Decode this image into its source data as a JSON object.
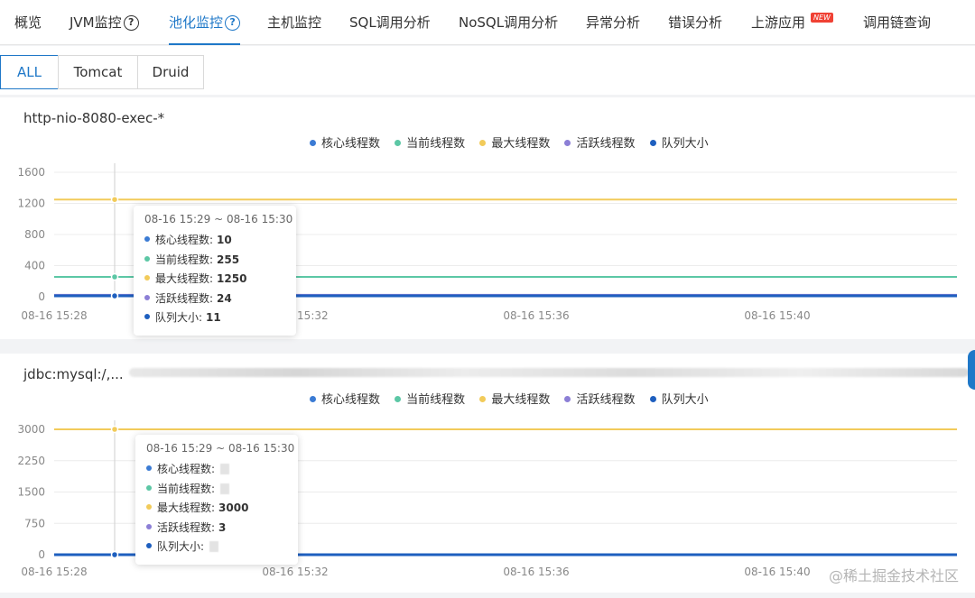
{
  "tabs": [
    {
      "label": "概览",
      "active": false,
      "help": false
    },
    {
      "label": "JVM监控",
      "active": false,
      "help": true
    },
    {
      "label": "池化监控",
      "active": true,
      "help": true
    },
    {
      "label": "主机监控",
      "active": false,
      "help": false
    },
    {
      "label": "SQL调用分析",
      "active": false,
      "help": false
    },
    {
      "label": "NoSQL调用分析",
      "active": false,
      "help": false
    },
    {
      "label": "异常分析",
      "active": false,
      "help": false
    },
    {
      "label": "错误分析",
      "active": false,
      "help": false
    },
    {
      "label": "上游应用",
      "active": false,
      "help": false,
      "badge": "NEW"
    },
    {
      "label": "调用链查询",
      "active": false,
      "help": false
    }
  ],
  "help_glyph": "?",
  "subtabs": [
    {
      "label": "ALL",
      "active": true
    },
    {
      "label": "Tomcat",
      "active": false
    },
    {
      "label": "Druid",
      "active": false
    }
  ],
  "colors": {
    "accent": "#1f78c8",
    "core": "#3b7bd4",
    "current": "#5cc7a5",
    "max": "#f2cb5a",
    "active": "#8c7fd6",
    "queue": "#1e5fbf"
  },
  "legend": [
    {
      "label": "核心线程数",
      "color_key": "core"
    },
    {
      "label": "当前线程数",
      "color_key": "current"
    },
    {
      "label": "最大线程数",
      "color_key": "max"
    },
    {
      "label": "活跃线程数",
      "color_key": "active"
    },
    {
      "label": "队列大小",
      "color_key": "queue"
    }
  ],
  "panels": [
    {
      "title": "http-nio-8080-exec-*",
      "tooltip": {
        "title": "08-16 15:29 ~ 08-16 15:30",
        "rows": [
          {
            "label": "核心线程数:",
            "value": "10",
            "color_key": "core"
          },
          {
            "label": "当前线程数:",
            "value": "255",
            "color_key": "current"
          },
          {
            "label": "最大线程数:",
            "value": "1250",
            "color_key": "max"
          },
          {
            "label": "活跃线程数:",
            "value": "24",
            "color_key": "active"
          },
          {
            "label": "队列大小:",
            "value": "11",
            "color_key": "queue"
          }
        ]
      }
    },
    {
      "title": "jdbc:mysql:/,...",
      "tooltip": {
        "title": "08-16 15:29 ~ 08-16 15:30",
        "rows": [
          {
            "label": "核心线程数:",
            "value": "",
            "color_key": "core"
          },
          {
            "label": "当前线程数:",
            "value": "",
            "color_key": "current"
          },
          {
            "label": "最大线程数:",
            "value": "3000",
            "color_key": "max"
          },
          {
            "label": "活跃线程数:",
            "value": "3",
            "color_key": "active"
          },
          {
            "label": "队列大小:",
            "value": "",
            "color_key": "queue"
          }
        ]
      }
    }
  ],
  "chart_data": [
    {
      "type": "line",
      "title": "http-nio-8080-exec-*",
      "x_ticks": [
        "08-16 15:28",
        "08-16 15:32",
        "08-16 15:36",
        "08-16 15:40"
      ],
      "y_ticks": [
        0,
        400,
        800,
        1200,
        1600
      ],
      "ylim": [
        0,
        1600
      ],
      "legend_position": "top-center",
      "grid": true,
      "series": [
        {
          "name": "核心线程数",
          "color_key": "core",
          "values": [
            10,
            10
          ]
        },
        {
          "name": "当前线程数",
          "color_key": "current",
          "values": [
            255,
            255
          ]
        },
        {
          "name": "最大线程数",
          "color_key": "max",
          "values": [
            1250,
            1250
          ]
        },
        {
          "name": "活跃线程数",
          "color_key": "active",
          "values": [
            24,
            24
          ]
        },
        {
          "name": "队列大小",
          "color_key": "queue",
          "values": [
            11,
            11
          ]
        }
      ]
    },
    {
      "type": "line",
      "title": "jdbc:mysql:/,...",
      "x_ticks": [
        "08-16 15:28",
        "08-16 15:32",
        "08-16 15:36",
        "08-16 15:40"
      ],
      "y_ticks": [
        0,
        750,
        1500,
        2250,
        3000
      ],
      "ylim": [
        0,
        3000
      ],
      "legend_position": "top-center",
      "grid": true,
      "series": [
        {
          "name": "核心线程数",
          "color_key": "core",
          "values": [
            0,
            0
          ]
        },
        {
          "name": "当前线程数",
          "color_key": "current",
          "values": [
            0,
            0
          ]
        },
        {
          "name": "最大线程数",
          "color_key": "max",
          "values": [
            3000,
            3000
          ]
        },
        {
          "name": "活跃线程数",
          "color_key": "active",
          "values": [
            3,
            3
          ]
        },
        {
          "name": "队列大小",
          "color_key": "queue",
          "values": [
            0,
            0
          ]
        }
      ]
    }
  ],
  "watermark": "@稀土掘金技术社区"
}
